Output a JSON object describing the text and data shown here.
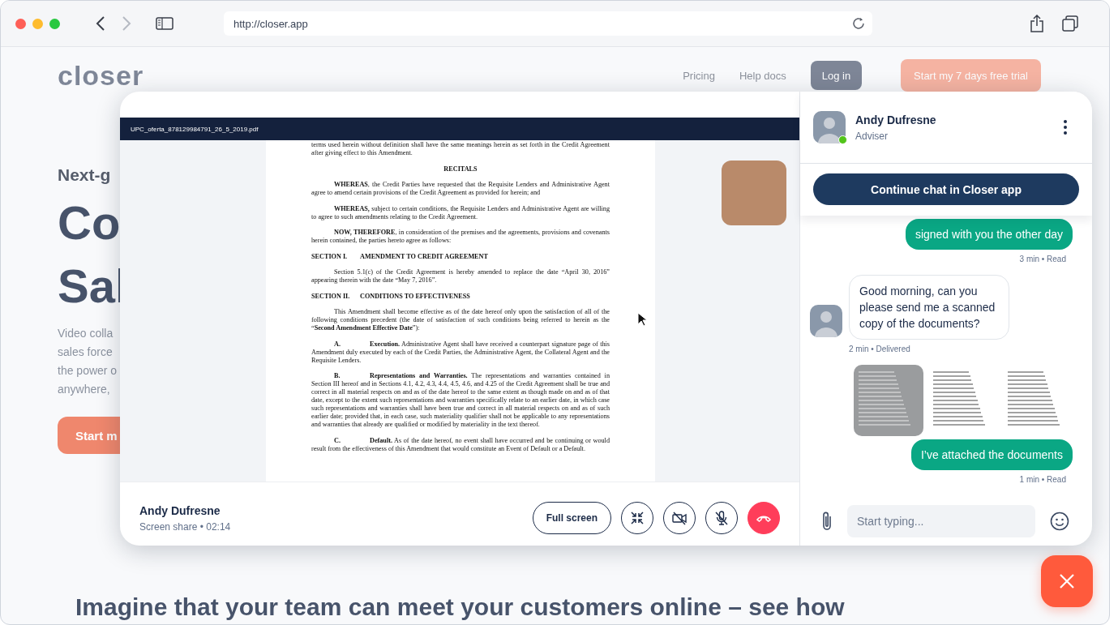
{
  "browser": {
    "url": "http://closer.app"
  },
  "site": {
    "logo": "closer",
    "nav": [
      {
        "kind": "link",
        "label": "Pricing"
      },
      {
        "kind": "link",
        "label": "Help docs"
      },
      {
        "kind": "secondary",
        "label": "Log in"
      },
      {
        "kind": "primary",
        "label": "Start my 7 days free trial"
      }
    ],
    "hero": {
      "eyebrow": "Next-g",
      "title_lines": [
        "Co",
        "Sal"
      ],
      "body_lines": [
        "Video colla",
        "sales force",
        "the power o",
        "anywhere,"
      ],
      "button": "Start m"
    },
    "section_heading": "Imagine that your team can meet your customers online – see how"
  },
  "call": {
    "document": {
      "filename": "UPC_oferta_878129984791_26_5_2019.pdf",
      "paragraphs": [
        {
          "kind": "continuation",
          "text": "terms used herein without definition shall have the same meanings herein as set forth in the Credit Agreement after giving effect to this Amendment."
        },
        {
          "kind": "heading",
          "text": "RECITALS"
        },
        {
          "kind": "para",
          "text": "**WHEREAS**, the Credit Parties have requested that the Requisite Lenders and Administrative Agent agree to amend certain provisions of the Credit Agreement as provided for herein; and"
        },
        {
          "kind": "para",
          "text": "**WHEREAS,** subject to certain conditions, the Requisite Lenders and Administrative Agent are willing to agree to such amendments relating to the Credit Agreement."
        },
        {
          "kind": "para",
          "text": "**NOW, THEREFORE**, in consideration of the premises and the agreements, provisions and covenants herein contained, the parties hereto agree as follows:"
        },
        {
          "kind": "section",
          "label": "SECTION I.",
          "text": "AMENDMENT TO CREDIT AGREEMENT"
        },
        {
          "kind": "para",
          "text": "Section 5.1(c) of the Credit Agreement is hereby amended to replace the date “April 30, 2016” appearing therein with the date “May 7, 2016”."
        },
        {
          "kind": "section",
          "label": "SECTION II.",
          "text": "CONDITIONS TO EFFECTIVENESS"
        },
        {
          "kind": "para",
          "text": "This Amendment shall become effective as of the date hereof only upon the satisfaction of all of the following conditions precedent (the date of satisfaction of such conditions being referred to herein as the “**Second Amendment Effective Date**”):"
        },
        {
          "kind": "item",
          "label": "A.",
          "text": "**Execution.** Administrative Agent shall have received a counterpart signature page of this Amendment duly executed by each of the Credit Parties, the Administrative Agent, the Collateral Agent and the Requisite Lenders."
        },
        {
          "kind": "item",
          "label": "B.",
          "text": "**Representations and Warranties.** The representations and warranties contained in Section III hereof and in Sections 4.1, 4.2, 4.3, 4.4, 4.5, 4.6, and 4.25 of the Credit Agreement shall be true and correct in all material respects on and as of the date hereof to the same extent as though made on and as of that date, except to the extent such representations and warranties specifically relate to an earlier date, in which case such representations and warranties shall have been true and correct in all material respects on and as of such earlier date; provided that, in each case, such materiality qualifier shall not be applicable to any representations and warranties that already are qualified or modified by materiality in the text thereof."
        },
        {
          "kind": "item",
          "label": "C.",
          "text": "**Default.** As of the date hereof, no event shall have occurred and be continuing or would result from the effectiveness of this Amendment that would constitute an Event of Default or a Default."
        }
      ]
    },
    "caller": {
      "name": "Andy Dufresne",
      "status": "Screen share • 02:14"
    },
    "controls": [
      {
        "kind": "text",
        "label": "Full screen"
      },
      {
        "kind": "collapse"
      },
      {
        "kind": "camera",
        "on": false
      },
      {
        "kind": "mic",
        "on": false
      },
      {
        "kind": "hangup"
      }
    ]
  },
  "chat": {
    "contact": {
      "name": "Andy Dufresne",
      "role": "Adviser",
      "online": true
    },
    "continue_button": "Continue chat in Closer app",
    "messages": [
      {
        "kind": "text",
        "outgoing": true,
        "text": "signed with you the other day",
        "meta": "3 min • Read"
      },
      {
        "kind": "text",
        "outgoing": false,
        "text": "Good morning, can you please send me a scanned copy of the documents?",
        "meta": "2 min • Delivered"
      },
      {
        "kind": "images",
        "images": [
          {
            "kind": "photo"
          },
          {
            "kind": "scan"
          },
          {
            "kind": "scan"
          }
        ]
      },
      {
        "kind": "text",
        "outgoing": true,
        "text": "I’ve attached the documents",
        "meta": "1 min • Read"
      }
    ],
    "input": {
      "placeholder": "Start typing..."
    }
  }
}
